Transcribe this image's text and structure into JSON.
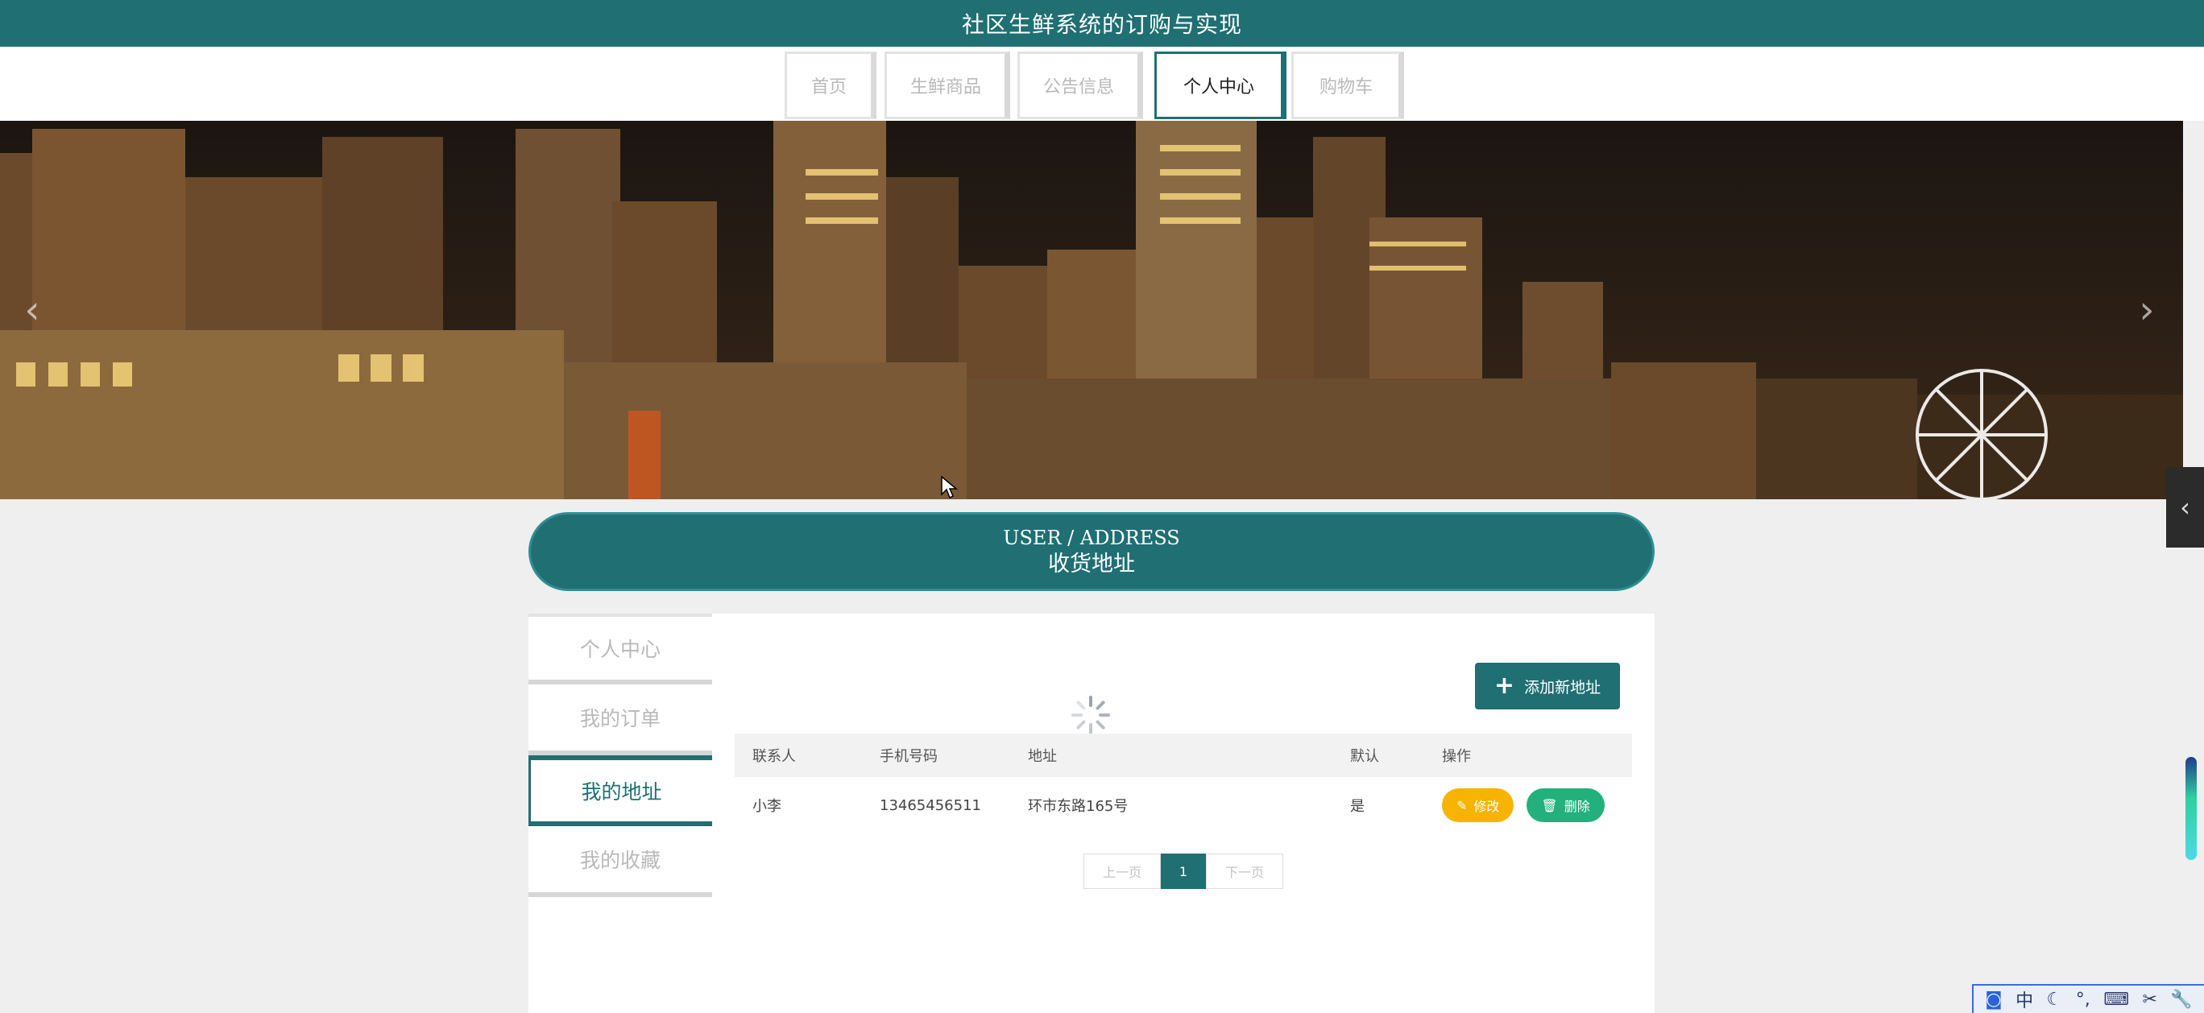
{
  "app": {
    "title": "社区生鲜系统的订购与实现"
  },
  "nav": {
    "items": [
      {
        "label": "首页",
        "active": false
      },
      {
        "label": "生鲜商品",
        "active": false
      },
      {
        "label": "公告信息",
        "active": false
      },
      {
        "label": "个人中心",
        "active": true
      },
      {
        "label": "购物车",
        "active": false
      }
    ]
  },
  "banner": {
    "prev_icon": "chevron-left-icon",
    "next_icon": "chevron-right-icon"
  },
  "section": {
    "title_en": "USER / ADDRESS",
    "title_cn": "收货地址"
  },
  "side_menu": {
    "items": [
      {
        "label": "个人中心",
        "active": false
      },
      {
        "label": "我的订单",
        "active": false
      },
      {
        "label": "我的地址",
        "active": true
      },
      {
        "label": "我的收藏",
        "active": false
      }
    ]
  },
  "actions": {
    "add_label": "添加新地址"
  },
  "table": {
    "headers": [
      "联系人",
      "手机号码",
      "地址",
      "默认",
      "操作"
    ],
    "rows": [
      {
        "contact": "小李",
        "phone": "13465456511",
        "address": "环市东路165号",
        "default": "是",
        "edit_label": "修改",
        "delete_label": "删除"
      }
    ]
  },
  "pagination": {
    "prev": "上一页",
    "current": "1",
    "next": "下一页"
  },
  "ime": {
    "lang": "中"
  },
  "colors": {
    "primary": "#1f6f73",
    "edit": "#f6b300",
    "delete": "#22b07d"
  }
}
